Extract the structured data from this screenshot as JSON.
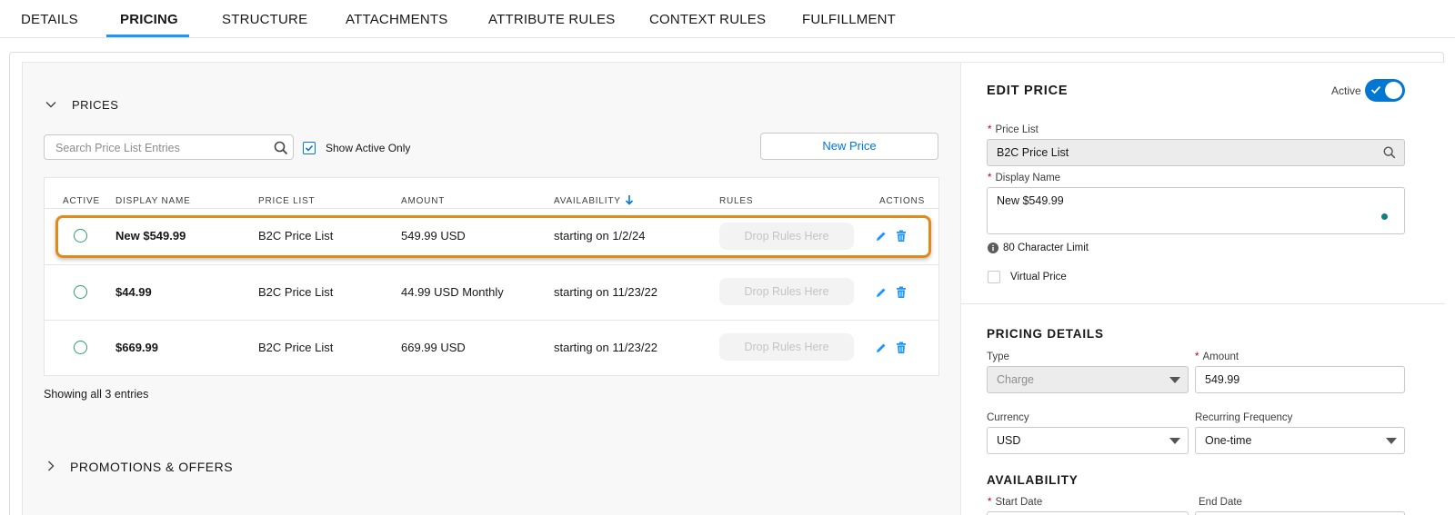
{
  "tabs": [
    "DETAILS",
    "PRICING",
    "STRUCTURE",
    "ATTACHMENTS",
    "ATTRIBUTE RULES",
    "CONTEXT RULES",
    "FULFILLMENT"
  ],
  "prices": {
    "section_title": "PRICES",
    "search_placeholder": "Search Price List Entries",
    "show_active_label": "Show Active Only",
    "show_active_checked": true,
    "new_price_label": "New Price",
    "columns": [
      "ACTIVE",
      "DISPLAY NAME",
      "PRICE LIST",
      "AMOUNT",
      "AVAILABILITY",
      "RULES",
      "ACTIONS"
    ],
    "rows": [
      {
        "display_name": "New $549.99",
        "price_list": "B2C Price List",
        "amount": "549.99 USD",
        "availability": "starting on 1/2/24",
        "rules": "Drop Rules Here"
      },
      {
        "display_name": "$44.99",
        "price_list": "B2C Price List",
        "amount": "44.99 USD Monthly",
        "availability": "starting on 11/23/22",
        "rules": "Drop Rules Here"
      },
      {
        "display_name": "$669.99",
        "price_list": "B2C Price List",
        "amount": "669.99 USD",
        "availability": "starting on 11/23/22",
        "rules": "Drop Rules Here"
      }
    ],
    "footer": "Showing all 3 entries"
  },
  "promotions": {
    "section_title": "PROMOTIONS & OFFERS"
  },
  "edit_price": {
    "title": "EDIT PRICE",
    "active_label": "Active",
    "active_on": true,
    "price_list_label": "Price List",
    "price_list_value": "B2C Price List",
    "display_name_label": "Display Name",
    "display_name_value": "New $549.99",
    "char_limit": "80 Character Limit",
    "virtual_price_label": "Virtual Price",
    "pricing_details_title": "PRICING DETAILS",
    "type_label": "Type",
    "type_value": "Charge",
    "amount_label": "Amount",
    "amount_value": "549.99",
    "currency_label": "Currency",
    "currency_value": "USD",
    "recurring_label": "Recurring Frequency",
    "recurring_value": "One-time",
    "availability_title": "AVAILABILITY",
    "start_date_label": "Start Date",
    "end_date_label": "End Date"
  },
  "colors": {
    "accent": "#0176d3",
    "highlight": "#e08a1a",
    "active_radio": "#2e9e6e"
  }
}
